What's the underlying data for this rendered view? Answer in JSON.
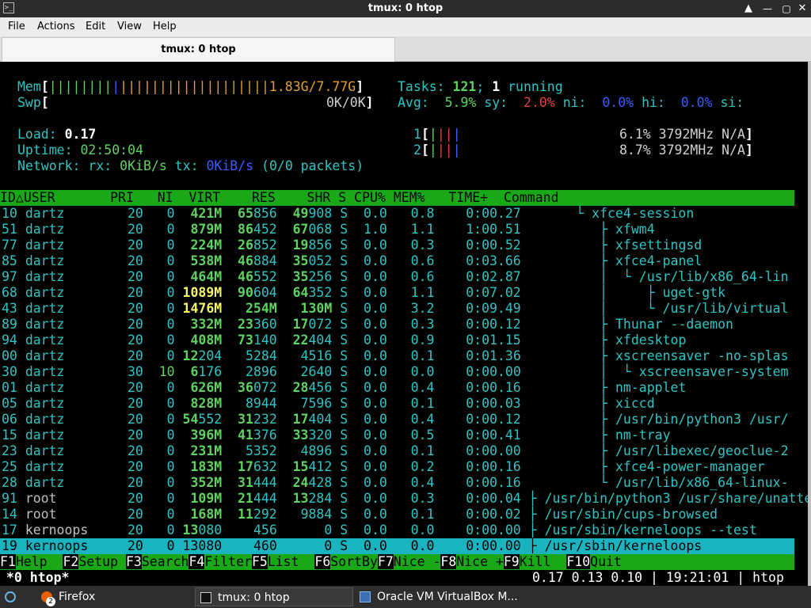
{
  "window": {
    "title": "tmux: 0 htop",
    "app_icon": "terminal-icon",
    "controls": [
      "minimize-icon",
      "maximize-icon",
      "close-icon"
    ]
  },
  "menu": [
    "File",
    "Actions",
    "Edit",
    "View",
    "Help"
  ],
  "tab": {
    "label": "tmux: 0 htop"
  },
  "meters": {
    "mem_label": "Mem",
    "mem_value": "1.83G/7.77G",
    "swp_label": "Swp",
    "swp_value": "0K/0K",
    "tasks_label": "Tasks:",
    "tasks_count": "121",
    "tasks_running": "1",
    "tasks_running_label": "running",
    "avg_label": "Avg:",
    "avg_us": "5.9%",
    "sy_label": "sy:",
    "sy_value": "2.0%",
    "ni_label": "ni:",
    "ni_value": "0.0%",
    "hi_label": "hi:",
    "hi_value": "0.0%",
    "si_label": "si:",
    "load_label": "Load:",
    "load_value": "0.17",
    "uptime_label": "Uptime:",
    "uptime_value": "02:50:04",
    "network_label": "Network:",
    "rx_label": "rx:",
    "rx_value": "0KiB/s",
    "tx_label": "tx:",
    "tx_value": "0KiB/s",
    "packets": "(0/0 packets)",
    "cpu1_label": "1",
    "cpu1_value": "6.1% 3792MHz N/A",
    "cpu2_label": "2",
    "cpu2_value": "8.7% 3792MHz N/A"
  },
  "columns": [
    "ID△",
    "USER",
    "PRI",
    "NI",
    "VIRT",
    "RES",
    "SHR",
    "S",
    "CPU%",
    "MEM%",
    "TIME+",
    "Command"
  ],
  "processes": [
    {
      "id": "10",
      "user": "dartz",
      "pri": "20",
      "ni": "0",
      "virt": "421M",
      "res_a": "65",
      "res_b": "856",
      "shr_a": "49",
      "shr_b": "908",
      "s": "S",
      "cpu": "0.0",
      "mem": "0.8",
      "time": "0:00.27",
      "tree": "      └ ",
      "cmd": "xfce4-session"
    },
    {
      "id": "51",
      "user": "dartz",
      "pri": "20",
      "ni": "0",
      "virt": "879M",
      "res_a": "86",
      "res_b": "452",
      "shr_a": "67",
      "shr_b": "068",
      "s": "S",
      "cpu": "1.0",
      "mem": "1.1",
      "time": "1:00.51",
      "tree": "         ├ ",
      "cmd": "xfwm4"
    },
    {
      "id": "77",
      "user": "dartz",
      "pri": "20",
      "ni": "0",
      "virt": "224M",
      "res_a": "26",
      "res_b": "852",
      "shr_a": "19",
      "shr_b": "856",
      "s": "S",
      "cpu": "0.0",
      "mem": "0.3",
      "time": "0:00.52",
      "tree": "         ├ ",
      "cmd": "xfsettingsd"
    },
    {
      "id": "85",
      "user": "dartz",
      "pri": "20",
      "ni": "0",
      "virt": "538M",
      "res_a": "46",
      "res_b": "884",
      "shr_a": "35",
      "shr_b": "052",
      "s": "S",
      "cpu": "0.0",
      "mem": "0.6",
      "time": "0:03.66",
      "tree": "         ├ ",
      "cmd": "xfce4-panel"
    },
    {
      "id": "97",
      "user": "dartz",
      "pri": "20",
      "ni": "0",
      "virt": "464M",
      "res_a": "46",
      "res_b": "552",
      "shr_a": "35",
      "shr_b": "256",
      "s": "S",
      "cpu": "0.0",
      "mem": "0.6",
      "time": "0:02.87",
      "tree": "         │  └ ",
      "cmd": "/usr/lib/x86_64-lin"
    },
    {
      "id": "68",
      "user": "dartz",
      "pri": "20",
      "ni": "0",
      "virt": "1089M",
      "res_a": "90",
      "res_b": "604",
      "shr_a": "64",
      "shr_b": "352",
      "s": "S",
      "cpu": "0.0",
      "mem": "1.1",
      "time": "0:07.02",
      "tree": "         │     ├ ",
      "cmd": "uget-gtk"
    },
    {
      "id": "43",
      "user": "dartz",
      "pri": "20",
      "ni": "0",
      "virt": "1476M",
      "res_a": "254M",
      "res_b": "",
      "shr_a": "130M",
      "shr_b": "",
      "s": "S",
      "cpu": "0.0",
      "mem": "3.2",
      "time": "0:09.49",
      "tree": "         │     └ ",
      "cmd": "/usr/lib/virtual"
    },
    {
      "id": "89",
      "user": "dartz",
      "pri": "20",
      "ni": "0",
      "virt": "332M",
      "res_a": "23",
      "res_b": "360",
      "shr_a": "17",
      "shr_b": "072",
      "s": "S",
      "cpu": "0.0",
      "mem": "0.3",
      "time": "0:00.12",
      "tree": "         ├ ",
      "cmd": "Thunar --daemon"
    },
    {
      "id": "94",
      "user": "dartz",
      "pri": "20",
      "ni": "0",
      "virt": "408M",
      "res_a": "73",
      "res_b": "140",
      "shr_a": "22",
      "shr_b": "404",
      "s": "S",
      "cpu": "0.0",
      "mem": "0.9",
      "time": "0:01.15",
      "tree": "         ├ ",
      "cmd": "xfdesktop"
    },
    {
      "id": "00",
      "user": "dartz",
      "pri": "20",
      "ni": "0",
      "virt": "12204",
      "res_a": "",
      "res_b": "5284",
      "shr_a": "",
      "shr_b": "4516",
      "s": "S",
      "cpu": "0.0",
      "mem": "0.1",
      "time": "0:01.36",
      "tree": "         ├ ",
      "cmd": "xscreensaver -no-splas"
    },
    {
      "id": "30",
      "user": "dartz",
      "pri": "30",
      "ni": "10",
      "virt": "6176",
      "res_a": "",
      "res_b": "2896",
      "shr_a": "",
      "shr_b": "2640",
      "s": "S",
      "cpu": "0.0",
      "mem": "0.0",
      "time": "0:00.00",
      "tree": "         │  └ ",
      "cmd": "xscreensaver-system"
    },
    {
      "id": "01",
      "user": "dartz",
      "pri": "20",
      "ni": "0",
      "virt": "626M",
      "res_a": "36",
      "res_b": "072",
      "shr_a": "28",
      "shr_b": "456",
      "s": "S",
      "cpu": "0.0",
      "mem": "0.4",
      "time": "0:00.16",
      "tree": "         ├ ",
      "cmd": "nm-applet"
    },
    {
      "id": "05",
      "user": "dartz",
      "pri": "20",
      "ni": "0",
      "virt": "828M",
      "res_a": "",
      "res_b": "8944",
      "shr_a": "",
      "shr_b": "7596",
      "s": "S",
      "cpu": "0.0",
      "mem": "0.1",
      "time": "0:00.03",
      "tree": "         ├ ",
      "cmd": "xiccd"
    },
    {
      "id": "06",
      "user": "dartz",
      "pri": "20",
      "ni": "0",
      "virt": "54552",
      "res_a": "31",
      "res_b": "232",
      "shr_a": "17",
      "shr_b": "404",
      "s": "S",
      "cpu": "0.0",
      "mem": "0.4",
      "time": "0:00.12",
      "tree": "         ├ ",
      "cmd": "/usr/bin/python3 /usr/"
    },
    {
      "id": "15",
      "user": "dartz",
      "pri": "20",
      "ni": "0",
      "virt": "396M",
      "res_a": "41",
      "res_b": "376",
      "shr_a": "33",
      "shr_b": "320",
      "s": "S",
      "cpu": "0.0",
      "mem": "0.5",
      "time": "0:00.41",
      "tree": "         ├ ",
      "cmd": "nm-tray"
    },
    {
      "id": "23",
      "user": "dartz",
      "pri": "20",
      "ni": "0",
      "virt": "231M",
      "res_a": "",
      "res_b": "5352",
      "shr_a": "",
      "shr_b": "4896",
      "s": "S",
      "cpu": "0.0",
      "mem": "0.1",
      "time": "0:00.00",
      "tree": "         ├ ",
      "cmd": "/usr/libexec/geoclue-2"
    },
    {
      "id": "25",
      "user": "dartz",
      "pri": "20",
      "ni": "0",
      "virt": "183M",
      "res_a": "17",
      "res_b": "632",
      "shr_a": "15",
      "shr_b": "412",
      "s": "S",
      "cpu": "0.0",
      "mem": "0.2",
      "time": "0:00.16",
      "tree": "         ├ ",
      "cmd": "xfce4-power-manager"
    },
    {
      "id": "28",
      "user": "dartz",
      "pri": "20",
      "ni": "0",
      "virt": "352M",
      "res_a": "31",
      "res_b": "444",
      "shr_a": "24",
      "shr_b": "428",
      "s": "S",
      "cpu": "0.0",
      "mem": "0.4",
      "time": "0:00.16",
      "tree": "         └ ",
      "cmd": "/usr/lib/x86_64-linux-"
    },
    {
      "id": "91",
      "user": "root",
      "pri": "20",
      "ni": "0",
      "virt": "109M",
      "res_a": "21",
      "res_b": "444",
      "shr_a": "13",
      "shr_b": "284",
      "s": "S",
      "cpu": "0.0",
      "mem": "0.3",
      "time": "0:00.04",
      "tree": "├ ",
      "cmd": "/usr/bin/python3 /usr/share/unattende"
    },
    {
      "id": "14",
      "user": "root",
      "pri": "20",
      "ni": "0",
      "virt": "168M",
      "res_a": "11",
      "res_b": "292",
      "shr_a": "",
      "shr_b": "9884",
      "s": "S",
      "cpu": "0.0",
      "mem": "0.1",
      "time": "0:00.02",
      "tree": "├ ",
      "cmd": "/usr/sbin/cups-browsed"
    },
    {
      "id": "17",
      "user": "kernoops",
      "pri": "20",
      "ni": "0",
      "virt": "13080",
      "res_a": "",
      "res_b": "456",
      "shr_a": "",
      "shr_b": "0",
      "s": "S",
      "cpu": "0.0",
      "mem": "0.0",
      "time": "0:00.00",
      "tree": "├ ",
      "cmd": "/usr/sbin/kerneloops --test"
    },
    {
      "id": "19",
      "user": "kernoops",
      "pri": "20",
      "ni": "0",
      "virt": "13080",
      "res_a": "",
      "res_b": "460",
      "shr_a": "",
      "shr_b": "0",
      "s": "S",
      "cpu": "0.0",
      "mem": "0.0",
      "time": "0:00.00",
      "tree": "├ ",
      "cmd": "/usr/sbin/kerneloops"
    }
  ],
  "selected_index": 21,
  "function_keys": [
    {
      "key": "F1",
      "label": "Help"
    },
    {
      "key": "F2",
      "label": "Setup"
    },
    {
      "key": "F3",
      "label": "Search"
    },
    {
      "key": "F4",
      "label": "Filter"
    },
    {
      "key": "F5",
      "label": "List"
    },
    {
      "key": "F6",
      "label": "SortBy"
    },
    {
      "key": "F7",
      "label": "Nice -"
    },
    {
      "key": "F8",
      "label": "Nice +"
    },
    {
      "key": "F9",
      "label": "Kill"
    },
    {
      "key": "F10",
      "label": "Quit"
    }
  ],
  "tmux_status": {
    "window": "*0 htop*",
    "right": "0.17 0.13 0.10 | 19:21:01 | htop"
  },
  "taskbar": {
    "items": [
      {
        "label": "Firefox",
        "icon": "firefox-icon",
        "badge": "2"
      },
      {
        "label": "tmux: 0 htop",
        "icon": "terminal-icon"
      },
      {
        "label": "Oracle VM VirtualBox M...",
        "icon": "virtualbox-icon"
      }
    ]
  }
}
